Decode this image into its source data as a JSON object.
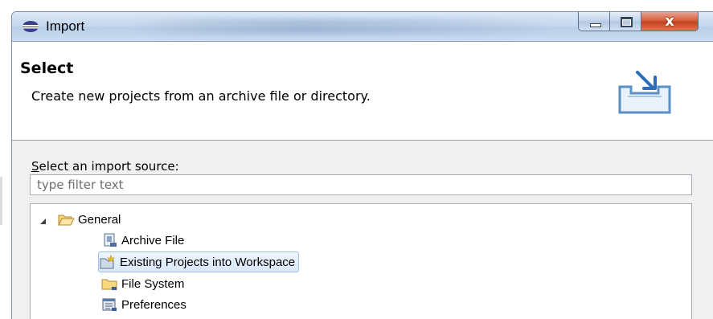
{
  "window": {
    "title": "Import",
    "icons": {
      "app": "import-app-icon",
      "minimize": "minimize-icon",
      "maximize": "maximize-icon",
      "close": "close-icon"
    },
    "close_glyph": "x"
  },
  "header": {
    "title": "Select",
    "description": "Create new projects from an archive file or directory.",
    "icon": "import-wizard-banner-icon"
  },
  "source": {
    "label_mnemonic": "S",
    "label_rest": "elect an import source:",
    "filter_placeholder": "type filter text",
    "filter_value": ""
  },
  "tree": {
    "items": [
      {
        "label": "General",
        "icon": "folder-open-icon",
        "expanded": true,
        "selected": false
      },
      {
        "label": "Archive File",
        "icon": "archive-file-icon",
        "selected": false
      },
      {
        "label": "Existing Projects into Workspace",
        "icon": "existing-projects-icon",
        "selected": true
      },
      {
        "label": "File System",
        "icon": "folder-icon",
        "selected": false
      },
      {
        "label": "Preferences",
        "icon": "preferences-icon",
        "selected": false
      }
    ]
  },
  "colors": {
    "titlebar": "#c6d9ef",
    "selection": "#d9e8fb",
    "close_button": "#c4421f"
  }
}
